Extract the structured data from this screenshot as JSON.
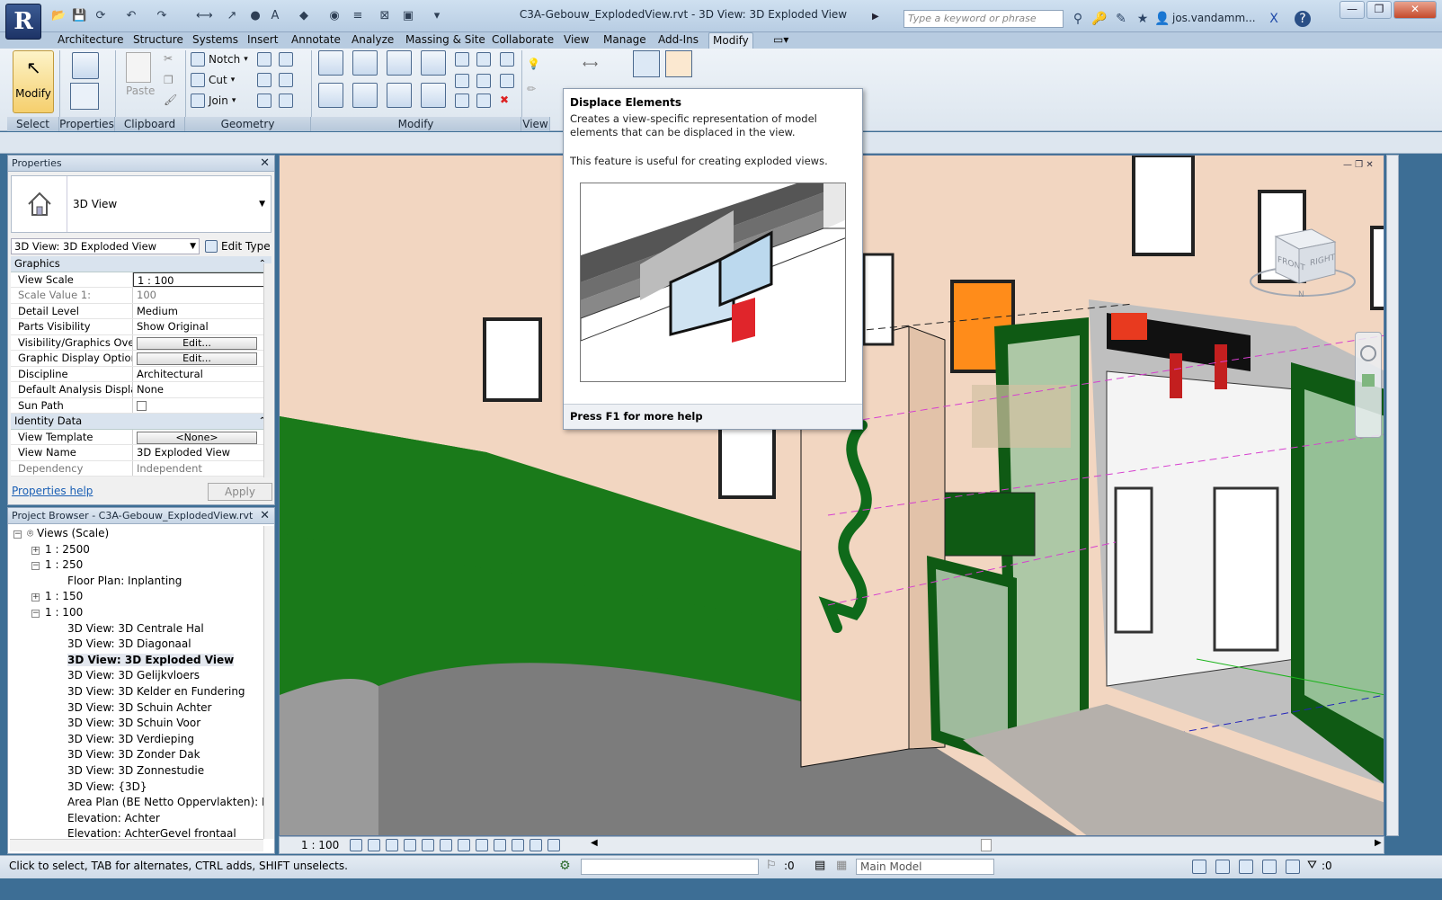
{
  "window": {
    "title": "C3A-Gebouw_ExplodedView.rvt - 3D View: 3D Exploded View",
    "app_logo": "R",
    "search_placeholder": "Type a keyword or phrase",
    "user": "jos.vandamm...",
    "minimize": "—",
    "restore": "❐",
    "close": "✕"
  },
  "tabs": [
    "Architecture",
    "Structure",
    "Systems",
    "Insert",
    "Annotate",
    "Analyze",
    "Massing & Site",
    "Collaborate",
    "View",
    "Manage",
    "Add-Ins",
    "Modify"
  ],
  "active_tab": "Modify",
  "ribbon": {
    "modify_label": "Modify",
    "paste_label": "Paste",
    "notch_label": "Notch",
    "cut_label": "Cut",
    "join_label": "Join",
    "groups": [
      "Select",
      "Properties",
      "Clipboard",
      "Geometry",
      "Modify",
      "View"
    ]
  },
  "tooltip": {
    "title": "Displace Elements",
    "desc1": "Creates a view-specific representation of model elements that can be displaced in the view.",
    "desc2": "This feature is useful for creating exploded views.",
    "footer": "Press F1 for more help"
  },
  "properties": {
    "panel_title": "Properties",
    "type_name": "3D View",
    "instance_selector": "3D View: 3D Exploded View",
    "edit_type": "Edit Type",
    "sections": [
      {
        "title": "Graphics",
        "rows": [
          {
            "k": "View Scale",
            "v": "1 : 100"
          },
          {
            "k": "Scale Value    1:",
            "v": "100"
          },
          {
            "k": "Detail Level",
            "v": "Medium"
          },
          {
            "k": "Parts Visibility",
            "v": "Show Original"
          },
          {
            "k": "Visibility/Graphics Ove...",
            "v": "Edit..."
          },
          {
            "k": "Graphic Display Options",
            "v": "Edit..."
          },
          {
            "k": "Discipline",
            "v": "Architectural"
          },
          {
            "k": "Default Analysis Displa...",
            "v": "None"
          },
          {
            "k": "Sun Path",
            "v": ""
          }
        ]
      },
      {
        "title": "Identity Data",
        "rows": [
          {
            "k": "View Template",
            "v": "<None>"
          },
          {
            "k": "View Name",
            "v": "3D Exploded View"
          },
          {
            "k": "Dependency",
            "v": "Independent"
          }
        ]
      }
    ],
    "help_link": "Properties help",
    "apply": "Apply"
  },
  "browser": {
    "panel_title": "Project Browser - C3A-Gebouw_ExplodedView.rvt",
    "items": [
      {
        "label": "Views (Scale)",
        "level": 0,
        "toggle": "−"
      },
      {
        "label": "1 : 2500",
        "level": 1,
        "toggle": "+"
      },
      {
        "label": "1 : 250",
        "level": 1,
        "toggle": "−"
      },
      {
        "label": "Floor Plan: Inplanting",
        "level": 2,
        "toggle": ""
      },
      {
        "label": "1 : 150",
        "level": 1,
        "toggle": "+"
      },
      {
        "label": "1 : 100",
        "level": 1,
        "toggle": "−"
      },
      {
        "label": "3D View: 3D Centrale Hal",
        "level": 2,
        "toggle": ""
      },
      {
        "label": "3D View: 3D Diagonaal",
        "level": 2,
        "toggle": ""
      },
      {
        "label": "3D View: 3D Exploded View",
        "level": 2,
        "toggle": "",
        "selected": true
      },
      {
        "label": "3D View: 3D Gelijkvloers",
        "level": 2,
        "toggle": ""
      },
      {
        "label": "3D View: 3D Kelder en Fundering",
        "level": 2,
        "toggle": ""
      },
      {
        "label": "3D View: 3D Schuin Achter",
        "level": 2,
        "toggle": ""
      },
      {
        "label": "3D View: 3D Schuin Voor",
        "level": 2,
        "toggle": ""
      },
      {
        "label": "3D View: 3D Verdieping",
        "level": 2,
        "toggle": ""
      },
      {
        "label": "3D View: 3D Zonder Dak",
        "level": 2,
        "toggle": ""
      },
      {
        "label": "3D View: 3D Zonnestudie",
        "level": 2,
        "toggle": ""
      },
      {
        "label": "3D View: {3D}",
        "level": 2,
        "toggle": ""
      },
      {
        "label": "Area Plan (BE Netto Oppervlakten): Heme",
        "level": 2,
        "toggle": ""
      },
      {
        "label": "Elevation: Achter",
        "level": 2,
        "toggle": ""
      },
      {
        "label": "Elevation: AchterGevel frontaal",
        "level": 2,
        "toggle": ""
      }
    ]
  },
  "viewcube": {
    "front": "FRONT",
    "right": "RIGHT",
    "n": "N"
  },
  "view_bar": {
    "scale": "1 : 100"
  },
  "status": {
    "hint": "Click to select, TAB for alternates, CTRL adds, SHIFT unselects.",
    "count": ":0",
    "model": "Main Model",
    "filter": ":0"
  }
}
